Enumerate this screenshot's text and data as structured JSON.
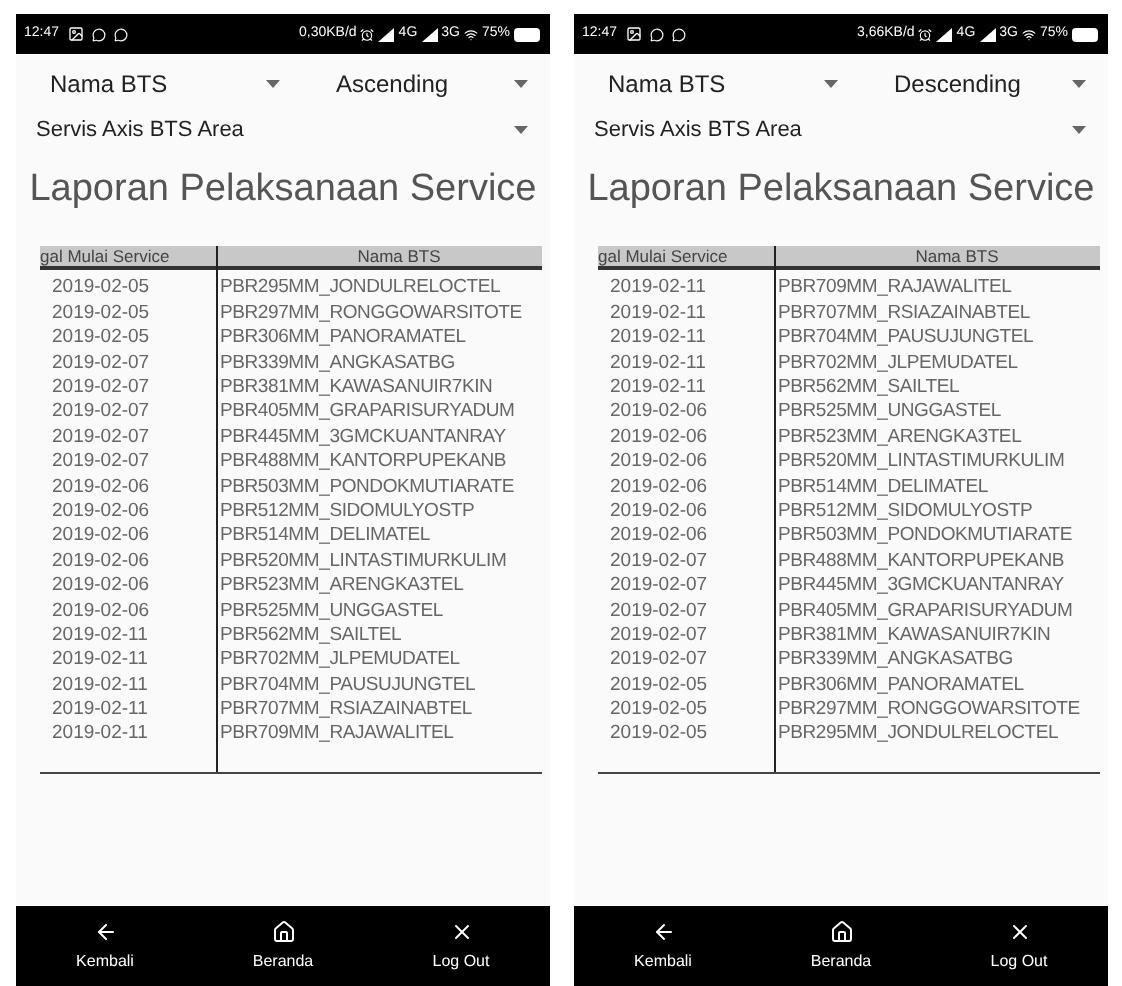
{
  "phones": [
    {
      "status_bar": {
        "time": "12:47",
        "speed": "0,30KB/d",
        "network_1": "4G",
        "network_2": "3G",
        "battery": "75%"
      },
      "sort_field": "Nama BTS",
      "sort_order": "Ascending",
      "area": "Servis Axis BTS Area",
      "title": "Laporan Pelaksanaan Service",
      "table": {
        "columns": [
          "gal Mulai Service",
          "Nama BTS"
        ],
        "rows": [
          [
            "2019-02-05",
            "PBR295MM_JONDULRELOCTEL"
          ],
          [
            "2019-02-05",
            "PBR297MM_RONGGOWARSITOTE"
          ],
          [
            "2019-02-05",
            "PBR306MM_PANORAMATEL"
          ],
          [
            "2019-02-07",
            "PBR339MM_ANGKASATBG"
          ],
          [
            "2019-02-07",
            "PBR381MM_KAWASANUIR7KIN"
          ],
          [
            "2019-02-07",
            "PBR405MM_GRAPARISURYADUM"
          ],
          [
            "2019-02-07",
            "PBR445MM_3GMCKUANTANRAY"
          ],
          [
            "2019-02-07",
            "PBR488MM_KANTORPUPEKANB"
          ],
          [
            "2019-02-06",
            "PBR503MM_PONDOKMUTIARATE"
          ],
          [
            "2019-02-06",
            "PBR512MM_SIDOMULYOSTP"
          ],
          [
            "2019-02-06",
            "PBR514MM_DELIMATEL"
          ],
          [
            "2019-02-06",
            "PBR520MM_LINTASTIMURKULIM"
          ],
          [
            "2019-02-06",
            "PBR523MM_ARENGKA3TEL"
          ],
          [
            "2019-02-06",
            "PBR525MM_UNGGASTEL"
          ],
          [
            "2019-02-11",
            "PBR562MM_SAILTEL"
          ],
          [
            "2019-02-11",
            "PBR702MM_JLPEMUDATEL"
          ],
          [
            "2019-02-11",
            "PBR704MM_PAUSUJUNGTEL"
          ],
          [
            "2019-02-11",
            "PBR707MM_RSIAZAINABTEL"
          ],
          [
            "2019-02-11",
            "PBR709MM_RAJAWALITEL"
          ]
        ]
      },
      "nav": [
        {
          "kind": "back",
          "label": "Kembali"
        },
        {
          "kind": "home",
          "label": "Beranda"
        },
        {
          "kind": "logout",
          "label": "Log Out"
        }
      ]
    },
    {
      "status_bar": {
        "time": "12:47",
        "speed": "3,66KB/d",
        "network_1": "4G",
        "network_2": "3G",
        "battery": "75%"
      },
      "sort_field": "Nama BTS",
      "sort_order": "Descending",
      "area": "Servis Axis BTS Area",
      "title": "Laporan Pelaksanaan Service",
      "table": {
        "columns": [
          "gal Mulai Service",
          "Nama BTS"
        ],
        "rows": [
          [
            "2019-02-11",
            "PBR709MM_RAJAWALITEL"
          ],
          [
            "2019-02-11",
            "PBR707MM_RSIAZAINABTEL"
          ],
          [
            "2019-02-11",
            "PBR704MM_PAUSUJUNGTEL"
          ],
          [
            "2019-02-11",
            "PBR702MM_JLPEMUDATEL"
          ],
          [
            "2019-02-11",
            "PBR562MM_SAILTEL"
          ],
          [
            "2019-02-06",
            "PBR525MM_UNGGASTEL"
          ],
          [
            "2019-02-06",
            "PBR523MM_ARENGKA3TEL"
          ],
          [
            "2019-02-06",
            "PBR520MM_LINTASTIMURKULIM"
          ],
          [
            "2019-02-06",
            "PBR514MM_DELIMATEL"
          ],
          [
            "2019-02-06",
            "PBR512MM_SIDOMULYOSTP"
          ],
          [
            "2019-02-06",
            "PBR503MM_PONDOKMUTIARATE"
          ],
          [
            "2019-02-07",
            "PBR488MM_KANTORPUPEKANB"
          ],
          [
            "2019-02-07",
            "PBR445MM_3GMCKUANTANRAY"
          ],
          [
            "2019-02-07",
            "PBR405MM_GRAPARISURYADUM"
          ],
          [
            "2019-02-07",
            "PBR381MM_KAWASANUIR7KIN"
          ],
          [
            "2019-02-07",
            "PBR339MM_ANGKASATBG"
          ],
          [
            "2019-02-05",
            "PBR306MM_PANORAMATEL"
          ],
          [
            "2019-02-05",
            "PBR297MM_RONGGOWARSITOTE"
          ],
          [
            "2019-02-05",
            "PBR295MM_JONDULRELOCTEL"
          ]
        ]
      },
      "nav": [
        {
          "kind": "back",
          "label": "Kembali"
        },
        {
          "kind": "home",
          "label": "Beranda"
        },
        {
          "kind": "logout",
          "label": "Log Out"
        }
      ]
    }
  ]
}
